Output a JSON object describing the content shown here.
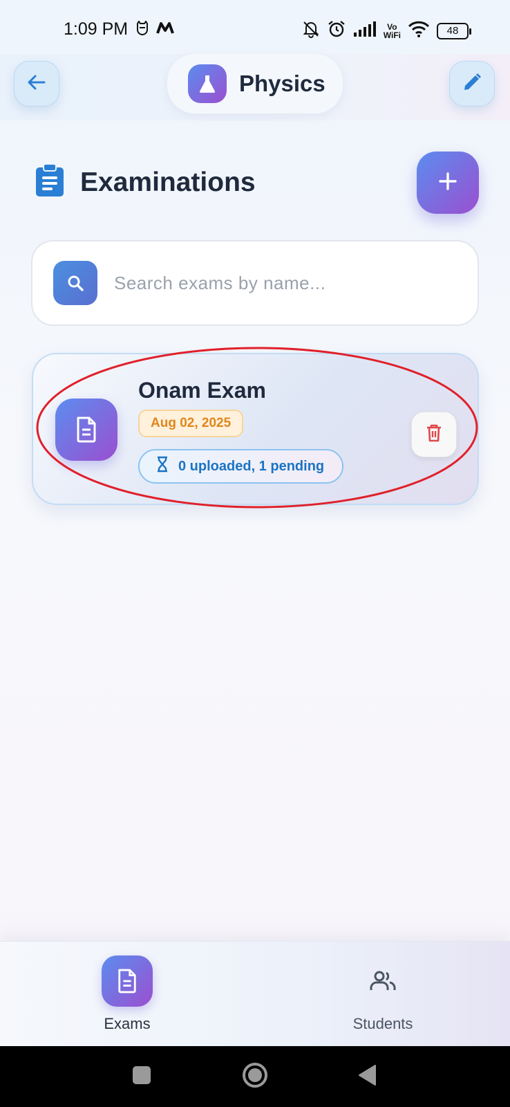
{
  "status_bar": {
    "time": "1:09 PM",
    "left_icons": [
      "cat-icon",
      "m-logo-icon"
    ],
    "right_icons": [
      "bell-off-icon",
      "alarm-icon",
      "signal-icon",
      "vowifi-icon",
      "wifi-icon",
      "battery-icon"
    ],
    "vowifi_top": "Vo",
    "vowifi_bottom": "WiFi",
    "battery_level": "48"
  },
  "header": {
    "title": "Physics",
    "back_icon": "arrow-left-icon",
    "title_icon": "flask-icon",
    "edit_icon": "pencil-icon"
  },
  "section": {
    "title": "Examinations",
    "icon": "clipboard-icon",
    "add_icon": "plus-icon"
  },
  "search": {
    "placeholder": "Search exams by name...",
    "value": ""
  },
  "exams": [
    {
      "name": "Onam Exam",
      "date": "Aug 02, 2025",
      "status": "0 uploaded, 1 pending",
      "icon": "document-icon",
      "status_icon": "hourglass-icon",
      "delete_icon": "trash-icon"
    }
  ],
  "bottom_nav": {
    "items": [
      {
        "label": "Exams",
        "icon": "document-icon",
        "active": true
      },
      {
        "label": "Students",
        "icon": "people-icon",
        "active": false
      }
    ]
  },
  "colors": {
    "accent_start": "#5b8def",
    "accent_end": "#9b4fd0",
    "date_text": "#e0861c",
    "status_text": "#1b74c4",
    "delete_icon": "#e04848",
    "highlight": "#e0202a"
  }
}
